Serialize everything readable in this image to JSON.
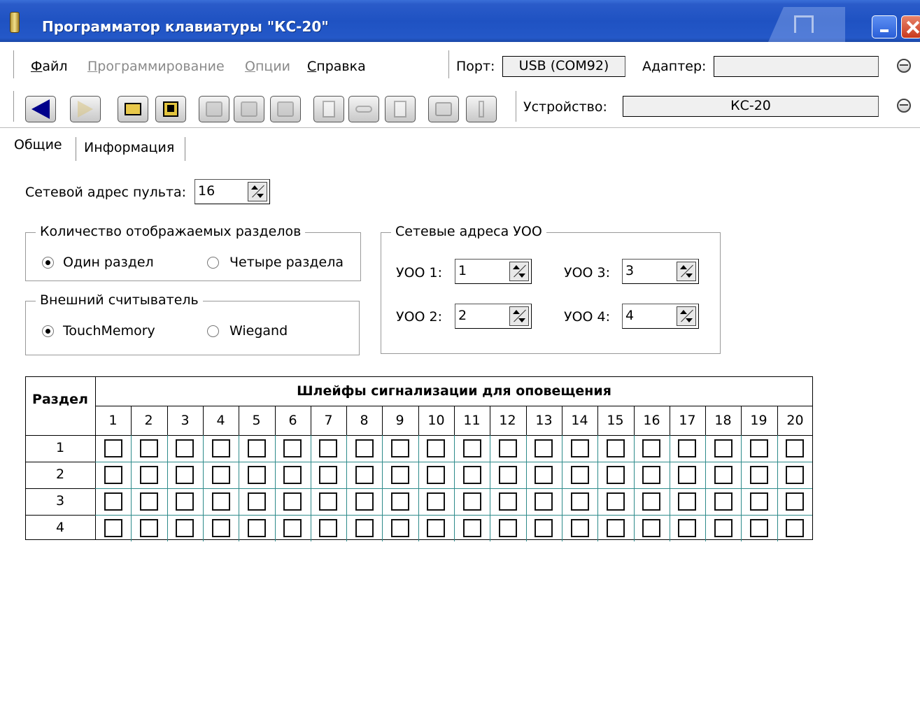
{
  "window": {
    "title": "Программатор клавиатуры \"КС-20\""
  },
  "menu": {
    "items": [
      {
        "label": "Файл",
        "acc": "Ф",
        "rest": "айл",
        "disabled": false
      },
      {
        "label": "Программирование",
        "acc": "П",
        "rest": "рограммирование",
        "disabled": true
      },
      {
        "label": "Опции",
        "acc": "О",
        "rest": "пции",
        "disabled": true
      },
      {
        "label": "Справка",
        "acc": "С",
        "rest": "правка",
        "disabled": false
      }
    ],
    "port_label": "Порт:",
    "port_value": "USB (COM92)",
    "adapter_label": "Адаптер:",
    "adapter_value": ""
  },
  "toolbar": {
    "buttons": [
      {
        "name": "back-button",
        "icon": "back-arrow-icon",
        "disabled": false
      },
      {
        "name": "forward-button",
        "icon": "forward-arrow-icon",
        "disabled": true
      },
      {
        "name": "open-button",
        "icon": "folder-icon",
        "disabled": false
      },
      {
        "name": "save-button",
        "icon": "floppy-disk-icon",
        "disabled": false
      },
      {
        "name": "read-button",
        "icon": "read-device-icon",
        "disabled": true
      },
      {
        "name": "write-button",
        "icon": "write-device-icon",
        "disabled": true
      },
      {
        "name": "chip-button",
        "icon": "chip-icon",
        "disabled": true
      },
      {
        "name": "config-button",
        "icon": "configure-icon",
        "disabled": true
      },
      {
        "name": "key-button",
        "icon": "key-icon",
        "disabled": true
      },
      {
        "name": "document-button",
        "icon": "document-icon",
        "disabled": true
      },
      {
        "name": "print-button",
        "icon": "printer-icon",
        "disabled": true
      },
      {
        "name": "info-button",
        "icon": "exclamation-icon",
        "disabled": true
      }
    ],
    "device_label": "Устройство:",
    "device_value": "КС-20"
  },
  "tabs": [
    {
      "label": "Общие",
      "active": true
    },
    {
      "label": "Информация",
      "active": false
    }
  ],
  "form": {
    "network_address_label": "Сетевой адрес пульта:",
    "network_address_value": "16",
    "sections_group": {
      "title": "Количество отображаемых разделов",
      "option1": "Один раздел",
      "option2": "Четыре раздела",
      "selected": 0
    },
    "reader_group": {
      "title": "Внешний считыватель",
      "option1": "TouchMemory",
      "option2": "Wiegand",
      "selected": 0
    },
    "uoo_group": {
      "title": "Сетевые адреса УОО",
      "uoo1_label": "УОО 1:",
      "uoo1_value": "1",
      "uoo2_label": "УОО 2:",
      "uoo2_value": "2",
      "uoo3_label": "УОО 3:",
      "uoo3_value": "3",
      "uoo4_label": "УОО 4:",
      "uoo4_value": "4"
    }
  },
  "grid": {
    "corner_label": "Раздел",
    "header_title": "Шлейфы сигнализации для оповещения",
    "columns": [
      "1",
      "2",
      "3",
      "4",
      "5",
      "6",
      "7",
      "8",
      "9",
      "10",
      "11",
      "12",
      "13",
      "14",
      "15",
      "16",
      "17",
      "18",
      "19",
      "20"
    ],
    "rows": [
      "1",
      "2",
      "3",
      "4"
    ],
    "checked": [
      [
        false,
        false,
        false,
        false,
        false,
        false,
        false,
        false,
        false,
        false,
        false,
        false,
        false,
        false,
        false,
        false,
        false,
        false,
        false,
        false
      ],
      [
        false,
        false,
        false,
        false,
        false,
        false,
        false,
        false,
        false,
        false,
        false,
        false,
        false,
        false,
        false,
        false,
        false,
        false,
        false,
        false
      ],
      [
        false,
        false,
        false,
        false,
        false,
        false,
        false,
        false,
        false,
        false,
        false,
        false,
        false,
        false,
        false,
        false,
        false,
        false,
        false,
        false
      ],
      [
        false,
        false,
        false,
        false,
        false,
        false,
        false,
        false,
        false,
        false,
        false,
        false,
        false,
        false,
        false,
        false,
        false,
        false,
        false,
        false
      ]
    ]
  }
}
